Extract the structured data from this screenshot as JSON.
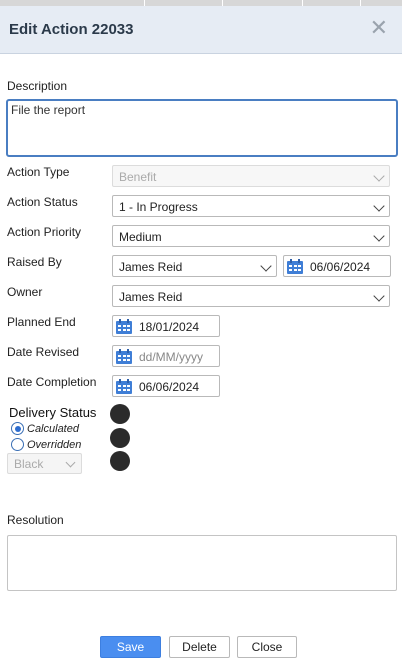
{
  "dialog": {
    "title": "Edit Action 22033",
    "close_glyph": "✕"
  },
  "description": {
    "label": "Description",
    "value": "File the report"
  },
  "fields": {
    "action_type": {
      "label": "Action Type",
      "value": "Benefit",
      "disabled": true
    },
    "action_status": {
      "label": "Action Status",
      "value": "1 - In Progress"
    },
    "action_priority": {
      "label": "Action Priority",
      "value": "Medium"
    },
    "raised_by": {
      "label": "Raised By",
      "value": "James Reid",
      "date": "06/06/2024"
    },
    "owner": {
      "label": "Owner",
      "value": "James Reid"
    },
    "planned_end": {
      "label": "Planned End",
      "date": "18/01/2024"
    },
    "date_revised": {
      "label": "Date Revised",
      "placeholder": "dd/MM/yyyy"
    },
    "date_completion": {
      "label": "Date Completion",
      "date": "06/06/2024"
    }
  },
  "delivery_status": {
    "title": "Delivery Status",
    "options": [
      "Calculated",
      "Overridden"
    ],
    "selected": "Calculated",
    "color_select": "Black",
    "indicator_color": "#2b2b2b"
  },
  "resolution": {
    "label": "Resolution",
    "value": ""
  },
  "buttons": {
    "save": "Save",
    "delete": "Delete",
    "close": "Close"
  },
  "colors": {
    "accent": "#4a8ef0",
    "header_bg": "#e6ecf4",
    "calendar_icon": "#3f7ed6"
  }
}
